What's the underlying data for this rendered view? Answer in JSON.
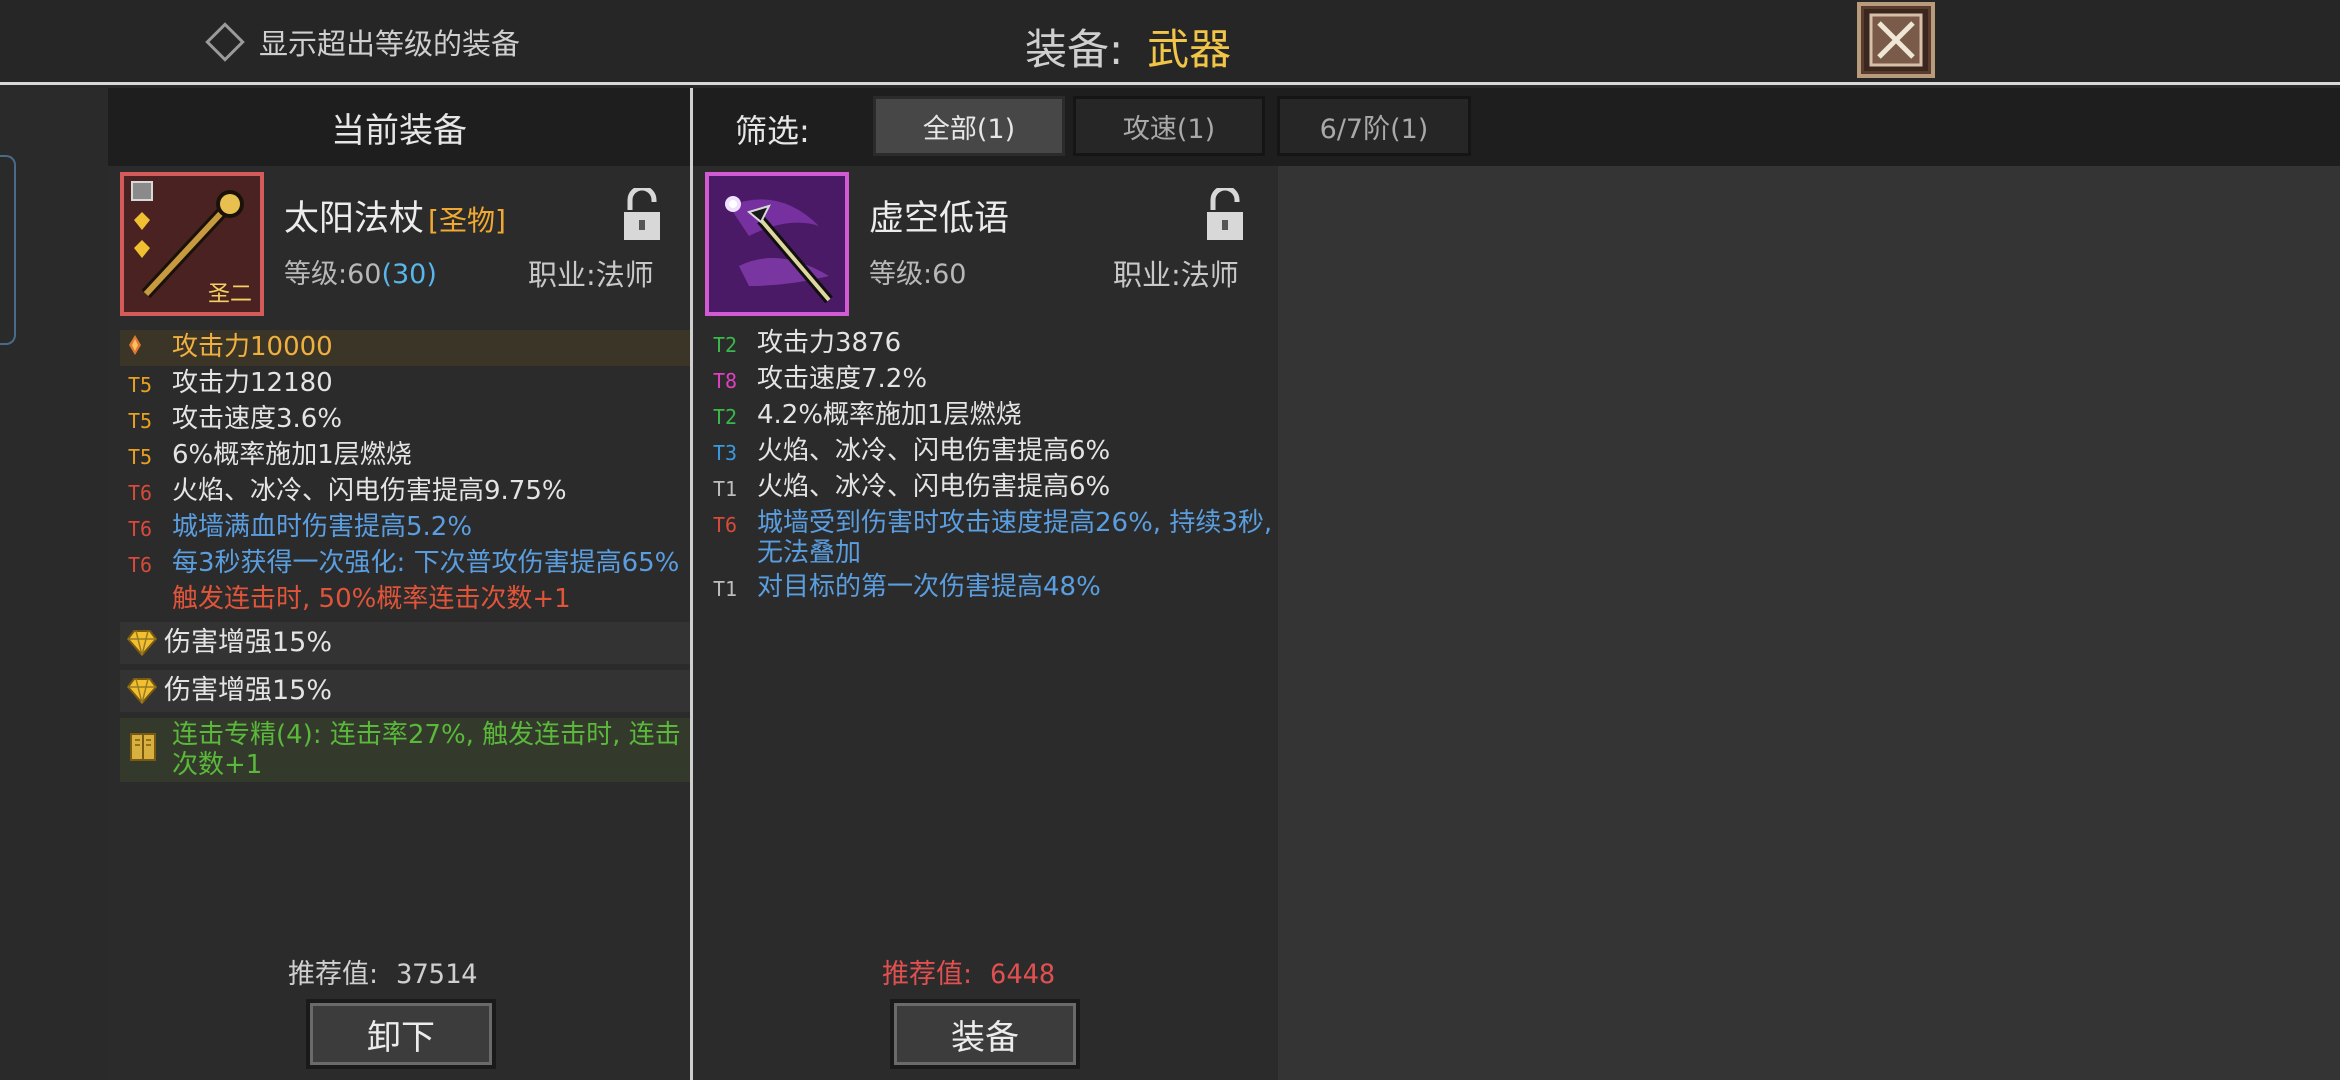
{
  "topbar": {
    "show_over_level": "显示超出等级的装备",
    "title_label": "装备:",
    "title_value": "武器"
  },
  "current": {
    "header": "当前装备",
    "name": "太阳法杖",
    "tag": "[圣物]",
    "icon_badge": "圣二",
    "level_label": "等级:",
    "level": "60",
    "level_extra": "(30)",
    "job_label": "职业:",
    "job": "法师",
    "stats": [
      {
        "tier": "",
        "text": "攻击力10000",
        "color": "gold",
        "tier_color": "gold"
      },
      {
        "tier": "T5",
        "text": "攻击力12180",
        "color": "white",
        "tier_color": "gold"
      },
      {
        "tier": "T5",
        "text": "攻击速度3.6%",
        "color": "white",
        "tier_color": "gold"
      },
      {
        "tier": "T5",
        "text": "6%概率施加1层燃烧",
        "color": "white",
        "tier_color": "gold"
      },
      {
        "tier": "T6",
        "text": "火焰、冰冷、闪电伤害提高9.75%",
        "color": "white",
        "tier_color": "red"
      },
      {
        "tier": "T6",
        "text": "城墙满血时伤害提高5.2%",
        "color": "blue",
        "tier_color": "red"
      },
      {
        "tier": "T6",
        "text": "每3秒获得一次强化: 下次普攻伤害提高65%",
        "color": "blue",
        "tier_color": "red"
      },
      {
        "tier": "",
        "text": "触发连击时, 50%概率连击次数+1",
        "color": "red",
        "tier_color": "red"
      }
    ],
    "gems": [
      "伤害增强15%",
      "伤害增强15%"
    ],
    "book": "连击专精(4): 连击率27%, 触发连击时, 连击次数+1",
    "recommend_label": "推荐值:",
    "recommend_value": "37514",
    "button": "卸下"
  },
  "filter": {
    "label": "筛选:",
    "tabs": [
      "全部(1)",
      "攻速(1)",
      "6/7阶(1)"
    ],
    "active": 0
  },
  "candidate": {
    "name": "虚空低语",
    "level_label": "等级:",
    "level": "60",
    "job_label": "职业:",
    "job": "法师",
    "stats": [
      {
        "tier": "T2",
        "text": "攻击力3876",
        "color": "white",
        "tier_color": "green"
      },
      {
        "tier": "T8",
        "text": "攻击速度7.2%",
        "color": "white",
        "tier_color": "pink"
      },
      {
        "tier": "T2",
        "text": "4.2%概率施加1层燃烧",
        "color": "white",
        "tier_color": "green"
      },
      {
        "tier": "T3",
        "text": "火焰、冰冷、闪电伤害提高6%",
        "color": "white",
        "tier_color": "blue"
      },
      {
        "tier": "T1",
        "text": "火焰、冰冷、闪电伤害提高6%",
        "color": "white",
        "tier_color": "grey"
      },
      {
        "tier": "T6",
        "text": "城墙受到伤害时攻击速度提高26%, 持续3秒, 无法叠加",
        "color": "blue",
        "tier_color": "red"
      },
      {
        "tier": "T1",
        "text": "对目标的第一次伤害提高48%",
        "color": "blue",
        "tier_color": "grey"
      }
    ],
    "recommend_label": "推荐值:",
    "recommend_value": "6448",
    "button": "装备"
  },
  "colors": {
    "accent_gold": "#f0c548",
    "holy_orange": "#f0a830",
    "stat_blue": "#5a9ee0",
    "stat_red": "#e0553a",
    "stat_green": "#5ab83a",
    "rec_red": "#e05050"
  },
  "icons": {
    "close": "close-x-icon",
    "lock": "unlocked-padlock-icon",
    "gem": "yellow-gem-icon",
    "book": "skill-book-icon",
    "flame": "flame-icon"
  }
}
